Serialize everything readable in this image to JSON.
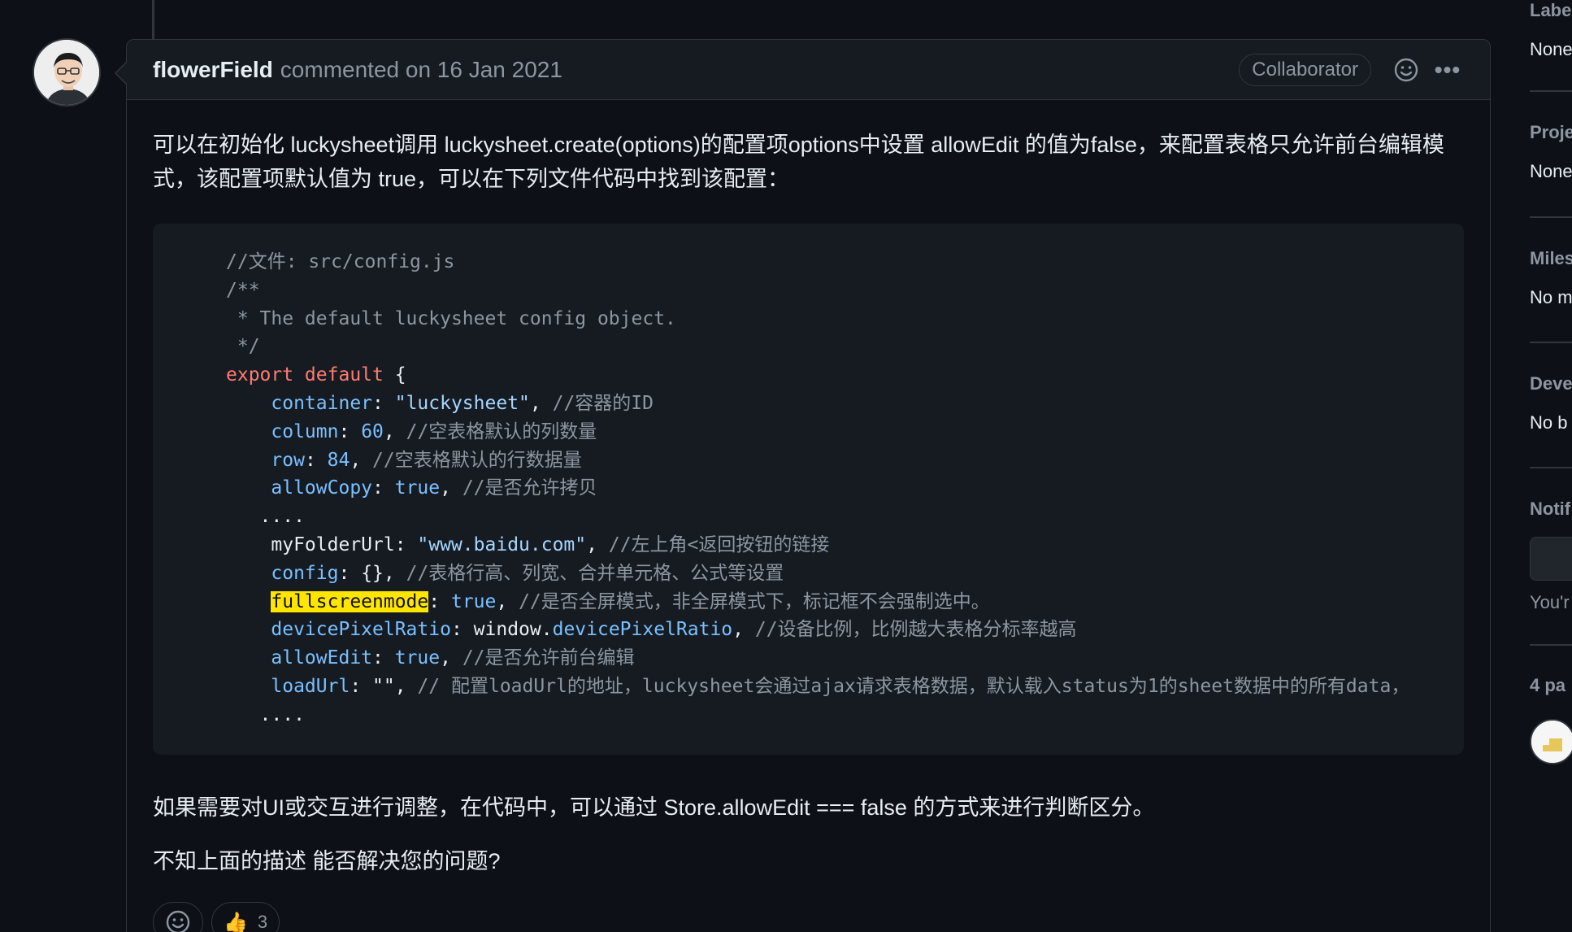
{
  "comment": {
    "author": "flowerField",
    "meta": "commented on 16 Jan 2021",
    "badge": "Collaborator",
    "more_label": "•••",
    "para1": "可以在初始化 luckysheet调用 luckysheet.create(options)的配置项options中设置 allowEdit 的值为false，来配置表格只允许前台编辑模式，该配置项默认值为 true，可以在下列文件代码中找到该配置：",
    "para2": "如果需要对UI或交互进行调整，在代码中，可以通过 Store.allowEdit === false 的方式来进行判断区分。",
    "para3": "不知上面的描述 能否解决您的问题?",
    "code": {
      "l1": "//文件: src/config.js",
      "l2": "/**",
      "l3": " * The default luckysheet config object.",
      "l4": " */",
      "l5_kw": "export default",
      "l5_rest": " {",
      "container_key": "container",
      "container_val": "\"luckysheet\"",
      "container_com": "//容器的ID",
      "column_key": "column",
      "column_val": "60",
      "column_com": "//空表格默认的列数量",
      "row_key": "row",
      "row_val": "84",
      "row_com": "//空表格默认的行数据量",
      "allowcopy_key": "allowCopy",
      "allowcopy_val": "true",
      "allowcopy_com": "//是否允许拷贝",
      "dots1": "....",
      "myfolder_key": "myFolderUrl",
      "myfolder_val": "\"www.baidu.com\"",
      "myfolder_com": "//左上角<返回按钮的链接",
      "config_key": "config",
      "config_val": "{}",
      "config_com": "//表格行高、列宽、合并单元格、公式等设置",
      "fullscreen_key": "fullscreenmode",
      "fullscreen_val": "true",
      "fullscreen_com": "//是否全屏模式，非全屏模式下，标记框不会强制选中。",
      "dpr_key": "devicePixelRatio",
      "dpr_obj": "window.",
      "dpr_prop": "devicePixelRatio",
      "dpr_com": "//设备比例，比例越大表格分标率越高",
      "allowedit_key": "allowEdit",
      "allowedit_val": "true",
      "allowedit_com": "//是否允许前台编辑",
      "loadurl_key": "loadUrl",
      "loadurl_val": "\"\"",
      "loadurl_com": "// 配置loadUrl的地址，luckysheet会通过ajax请求表格数据，默认载入status为1的sheet数据中的所有data，",
      "dots2": "...."
    },
    "reactions": {
      "add_icon": "smiley-icon",
      "thumbs_emoji": "👍",
      "thumbs_count": "3"
    }
  },
  "sidebar": {
    "labels_title": "Labe",
    "labels_value": "None",
    "projects_title": "Proje",
    "projects_value": "None",
    "milestone_title": "Miles",
    "milestone_value": "No m",
    "development_title": "Deve",
    "development_value": "No b",
    "notifications_title": "Notif",
    "notifications_note": "You'r",
    "participants_title": "4 pa"
  },
  "colors": {
    "background": "#0d1117",
    "header": "#161b22",
    "border": "#30363d",
    "muted": "#8d96a0",
    "highlight": "#ffe500",
    "keyword": "#ff7b72",
    "property": "#79c0ff"
  }
}
